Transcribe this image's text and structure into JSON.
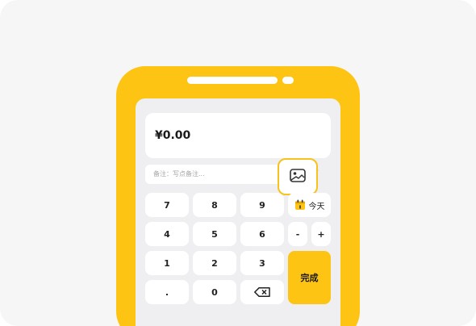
{
  "amount": {
    "value": "¥0.00"
  },
  "note": {
    "label": "备注：写点备注..."
  },
  "keypad": {
    "rows": [
      [
        "7",
        "8",
        "9"
      ],
      [
        "4",
        "5",
        "6"
      ],
      [
        "1",
        "2",
        "3"
      ],
      [
        ".",
        "0"
      ]
    ],
    "today_label": "今天",
    "minus": "-",
    "plus": "+",
    "done": "完成"
  },
  "colors": {
    "accent": "#fdc414",
    "card_bg": "#f6f6f6",
    "screen_bg": "#efeff1"
  },
  "icons": [
    "image-icon",
    "calendar-icon",
    "backspace-icon"
  ]
}
